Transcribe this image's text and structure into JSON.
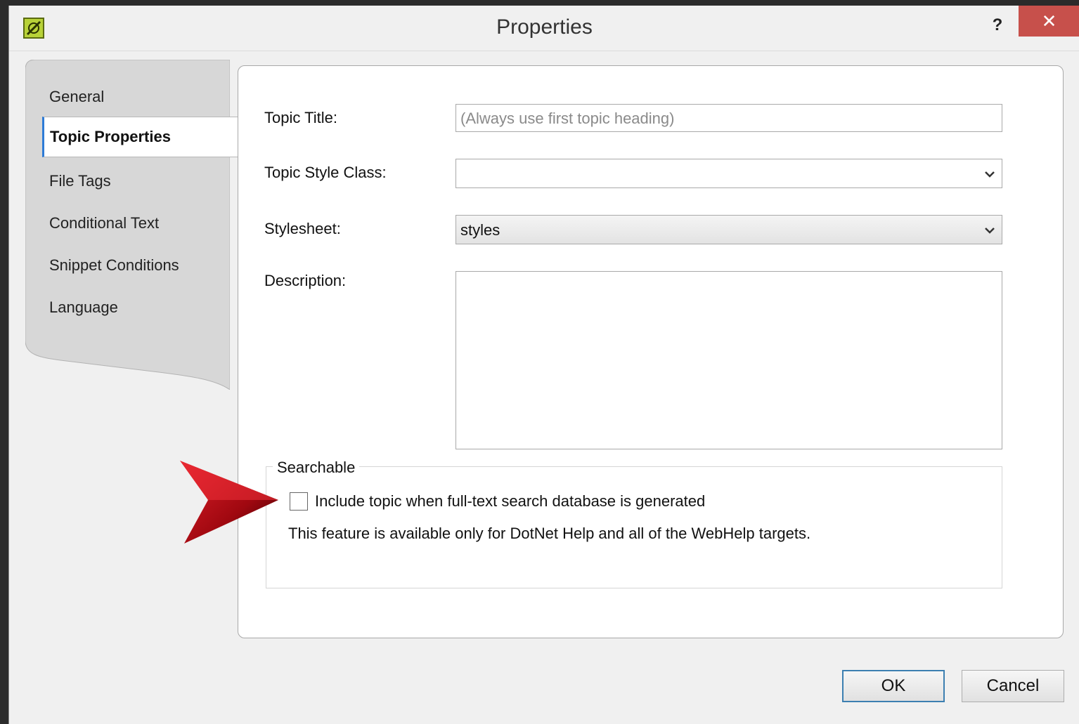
{
  "window": {
    "title": "Properties",
    "help": "?",
    "close": "✕"
  },
  "sidebar": {
    "items": [
      {
        "label": "General"
      },
      {
        "label": "Topic Properties"
      },
      {
        "label": "File Tags"
      },
      {
        "label": "Conditional Text"
      },
      {
        "label": "Snippet Conditions"
      },
      {
        "label": "Language"
      }
    ],
    "active_index": 1
  },
  "form": {
    "topic_title_label": "Topic Title:",
    "topic_title_placeholder": "(Always use first topic heading)",
    "style_class_label": "Topic Style Class:",
    "style_class_value": "",
    "stylesheet_label": "Stylesheet:",
    "stylesheet_value": "styles",
    "description_label": "Description:",
    "description_value": ""
  },
  "searchable": {
    "title": "Searchable",
    "checkbox_label": "Include topic when full-text search database is generated",
    "checked": false,
    "note": "This feature is available only for DotNet Help and all of the WebHelp targets."
  },
  "buttons": {
    "ok": "OK",
    "cancel": "Cancel"
  },
  "colors": {
    "close_bg": "#c7504b",
    "active_tab_accent": "#2d7bd6",
    "arrow": "#c0101a"
  }
}
